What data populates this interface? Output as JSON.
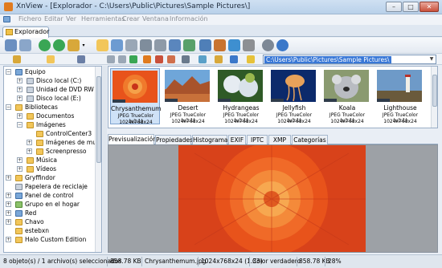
{
  "window": {
    "title": "XnView - [Explorador - C:\\Users\\Public\\Pictures\\Sample Pictures\\]"
  },
  "menu": [
    "Fichero",
    "Editar",
    "Ver",
    "Herramientas",
    "Crear",
    "Ventana",
    "Información"
  ],
  "doc_tab": "Explorador",
  "address": {
    "path": "C:\\Users\\Public\\Pictures\\Sample Pictures\\"
  },
  "tree": [
    {
      "label": "Equipo"
    },
    {
      "label": "Disco local (C:)"
    },
    {
      "label": "Unidad de DVD RW (D"
    },
    {
      "label": "Disco local (E:)"
    },
    {
      "label": "Bibliotecas"
    },
    {
      "label": "Documentos"
    },
    {
      "label": "Imágenes"
    },
    {
      "label": "ControlCenter3"
    },
    {
      "label": "Imágenes de mue:"
    },
    {
      "label": "Screenpresso"
    },
    {
      "label": "Música"
    },
    {
      "label": "Vídeos"
    },
    {
      "label": "Gryffindor"
    },
    {
      "label": "Papelera de reciclaje"
    },
    {
      "label": "Panel de control"
    },
    {
      "label": "Grupo en el hogar"
    },
    {
      "label": "Red"
    },
    {
      "label": "Chavo"
    },
    {
      "label": "estebxn"
    },
    {
      "label": "Halo Custom Edition"
    }
  ],
  "thumbnails": [
    {
      "name": "Chrysanthemum",
      "format": "JPEG TrueColor (v1.1)",
      "dims": "1024x768x24"
    },
    {
      "name": "Desert",
      "format": "JPEG TrueColor (v1.1)",
      "dims": "1024x768x24"
    },
    {
      "name": "Hydrangeas",
      "format": "JPEG TrueColor (v1.1)",
      "dims": "1024x768x24"
    },
    {
      "name": "Jellyfish",
      "format": "JPEG TrueColor (v1.1)",
      "dims": "1024x768x24"
    },
    {
      "name": "Koala",
      "format": "JPEG TrueColor (v1.1)",
      "dims": "1024x768x24"
    },
    {
      "name": "Lighthouse",
      "format": "JPEG TrueColor (v1.1)",
      "dims": "1024x768x24"
    }
  ],
  "panel_tabs": [
    "Previsualización",
    "Propiedades",
    "Histograma",
    "EXIF",
    "IPTC",
    "XMP",
    "Categorías"
  ],
  "status": {
    "selection": "8 objeto(s) / 1 archivo(s) seleccionados",
    "selection_size": "858.78 KB",
    "filename": "Chrysanthemum.jpg",
    "dims": "1024x768x24 (1.33)",
    "color": "Color verdadero",
    "file_size": "858.78 KB",
    "zoom": "28%"
  },
  "colors": {
    "accent": "#3877d6",
    "selection": "#cfe2f7",
    "flower": "#e8531b"
  }
}
